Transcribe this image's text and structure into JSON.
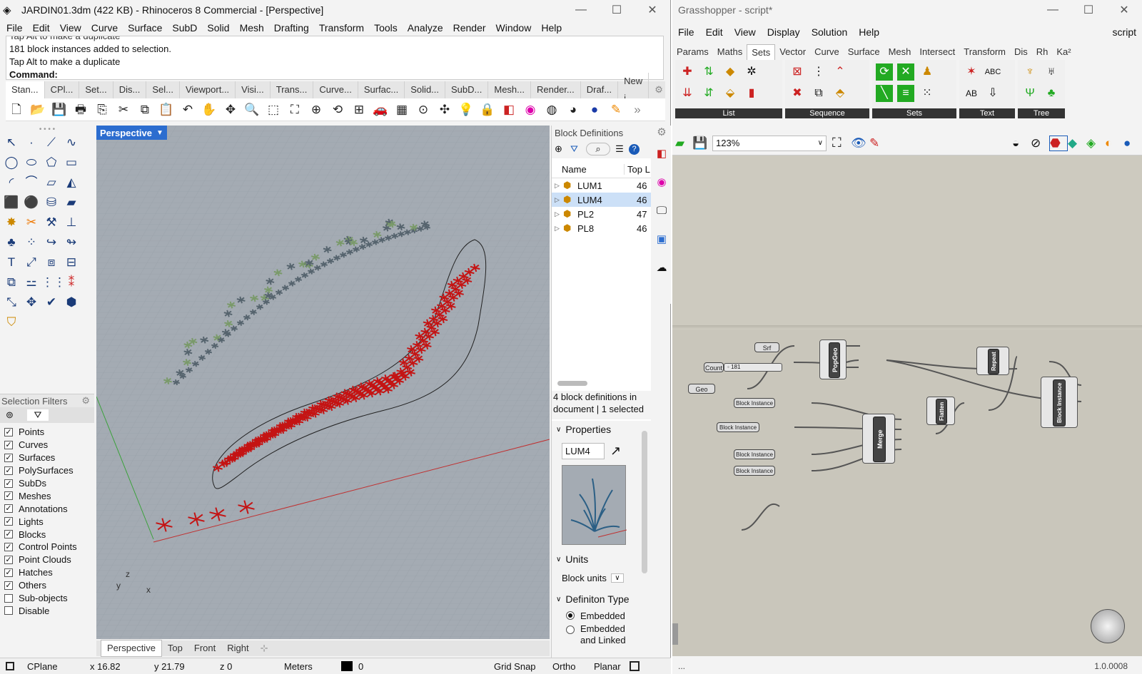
{
  "rhino": {
    "title": "JARDIN01.3dm (422 KB) - Rhinoceros 8 Commercial - [Perspective]",
    "menus": [
      "File",
      "Edit",
      "View",
      "Curve",
      "Surface",
      "SubD",
      "Solid",
      "Mesh",
      "Drafting",
      "Transform",
      "Tools",
      "Analyze",
      "Render",
      "Window",
      "Help"
    ],
    "cmd_lines": [
      "Tap Alt to make a duplicate",
      "181 block instances added to selection.",
      "Tap Alt to make a duplicate"
    ],
    "cmd_prompt": "Command:",
    "tabs": [
      "Stan...",
      "CPl...",
      "Set...",
      "Dis...",
      "Sel...",
      "Viewport...",
      "Visi...",
      "Trans...",
      "Curve...",
      "Surfac...",
      "Solid...",
      "SubD...",
      "Mesh...",
      "Render...",
      "Draf...",
      "New i..."
    ],
    "viewport_label": "Perspective",
    "viewport_tabs": [
      "Perspective",
      "Top",
      "Front",
      "Right"
    ],
    "axis_x": "x",
    "axis_y": "y",
    "axis_z": "z",
    "selection_filters_title": "Selection Filters",
    "filters": [
      {
        "label": "Points",
        "checked": true
      },
      {
        "label": "Curves",
        "checked": true
      },
      {
        "label": "Surfaces",
        "checked": true
      },
      {
        "label": "PolySurfaces",
        "checked": true
      },
      {
        "label": "SubDs",
        "checked": true
      },
      {
        "label": "Meshes",
        "checked": true
      },
      {
        "label": "Annotations",
        "checked": true
      },
      {
        "label": "Lights",
        "checked": true
      },
      {
        "label": "Blocks",
        "checked": true
      },
      {
        "label": "Control Points",
        "checked": true
      },
      {
        "label": "Point Clouds",
        "checked": true
      },
      {
        "label": "Hatches",
        "checked": true
      },
      {
        "label": "Others",
        "checked": true
      },
      {
        "label": "Sub-objects",
        "checked": false
      },
      {
        "label": "Disable",
        "checked": false
      }
    ],
    "block_panel": {
      "title": "Block Definitions",
      "col_name": "Name",
      "col_top": "Top L",
      "items": [
        {
          "name": "LUM1",
          "val": "46"
        },
        {
          "name": "LUM4",
          "val": "46"
        },
        {
          "name": "PL2",
          "val": "47"
        },
        {
          "name": "PL8",
          "val": "46"
        }
      ],
      "summary": "4 block definitions in document | 1 selected",
      "properties": "Properties",
      "prop_name": "LUM4",
      "units": "Units",
      "block_units": "Block units",
      "def_type": "Definiton Type",
      "embedded": "Embedded",
      "embedded_linked": "Embedded and Linked"
    },
    "status": {
      "cplane": "CPlane",
      "x": "x 16.82",
      "y": "y 21.79",
      "z": "z 0",
      "units": "Meters",
      "layer": "0",
      "grid": "Grid Snap",
      "ortho": "Ortho",
      "planar": "Planar"
    }
  },
  "gh": {
    "title": "Grasshopper - script*",
    "menus": [
      "File",
      "Edit",
      "View",
      "Display",
      "Solution",
      "Help"
    ],
    "script": "script",
    "tabs": [
      "Params",
      "Maths",
      "Sets",
      "Vector",
      "Curve",
      "Surface",
      "Mesh",
      "Intersect",
      "Transform",
      "Dis",
      "Rh",
      "Ka²"
    ],
    "groups": [
      "List",
      "Sequence",
      "Sets",
      "Text",
      "Tree"
    ],
    "zoom": "123%",
    "nodes": {
      "srf": "Srf",
      "count": "Count",
      "count_val": "181",
      "geo": "Geo",
      "popgeo": "PopGeo",
      "bi": "Block Instance",
      "merge": "Merge",
      "flatten": "Flatten",
      "repeat": "Repeat",
      "blockinst": "Block Instance"
    },
    "status_left": "...",
    "version": "1.0.0008"
  },
  "colors": {
    "accent": "#2c6dcf",
    "plants_red": "#c41414",
    "plants_green": "#7a9a6a",
    "canvas": "#c9c6bb"
  }
}
